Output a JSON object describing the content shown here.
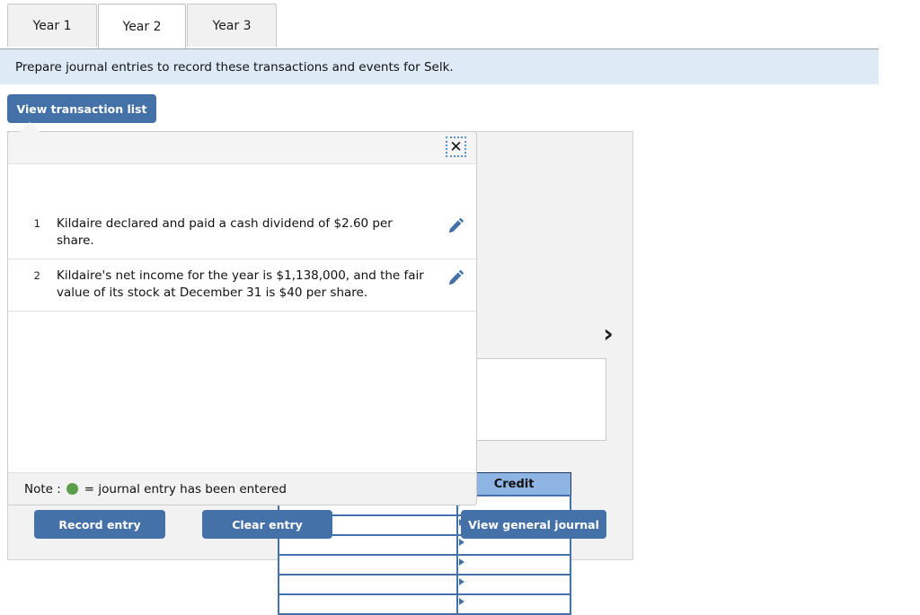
{
  "tabs": [
    {
      "label": "Year 1",
      "active": false
    },
    {
      "label": "Year 2",
      "active": true
    },
    {
      "label": "Year 3",
      "active": false
    }
  ],
  "instruction": {
    "text": "Prepare journal entries to record these transactions and events for Selk."
  },
  "toolbar": {
    "view_transaction_list_label": "View transaction list"
  },
  "popup": {
    "close_label": "✕",
    "transactions": [
      {
        "number": "1",
        "description": "Kildaire declared and paid a cash dividend of $2.60 per share.",
        "edit_icon": "pencil-icon"
      },
      {
        "number": "2",
        "description": "Kildaire's net income for the year is $1,138,000, and the fair value of its stock at December 31 is $40 per share.",
        "edit_icon": "pencil-icon"
      }
    ],
    "note_prefix": "Note : ",
    "note_suffix": "= journal entry has been entered"
  },
  "journal": {
    "next_arrow": "›",
    "columns": [
      "",
      "Credit"
    ],
    "rows": [
      {
        "debit": "",
        "credit": ""
      },
      {
        "debit": "",
        "credit": ""
      },
      {
        "debit": "",
        "credit": ""
      },
      {
        "debit": "",
        "credit": ""
      },
      {
        "debit": "",
        "credit": ""
      },
      {
        "debit": "",
        "credit": ""
      }
    ]
  },
  "footer": {
    "record_entry_label": "Record entry",
    "clear_entry_label": "Clear entry",
    "view_general_journal_label": "View general journal"
  },
  "colors": {
    "accent_blue": "#4472a8",
    "banner_blue": "#dfeaf7",
    "table_header_blue": "#8eb4e3",
    "note_green": "#5a9e4b",
    "panel_gray": "#f2f2f2"
  }
}
